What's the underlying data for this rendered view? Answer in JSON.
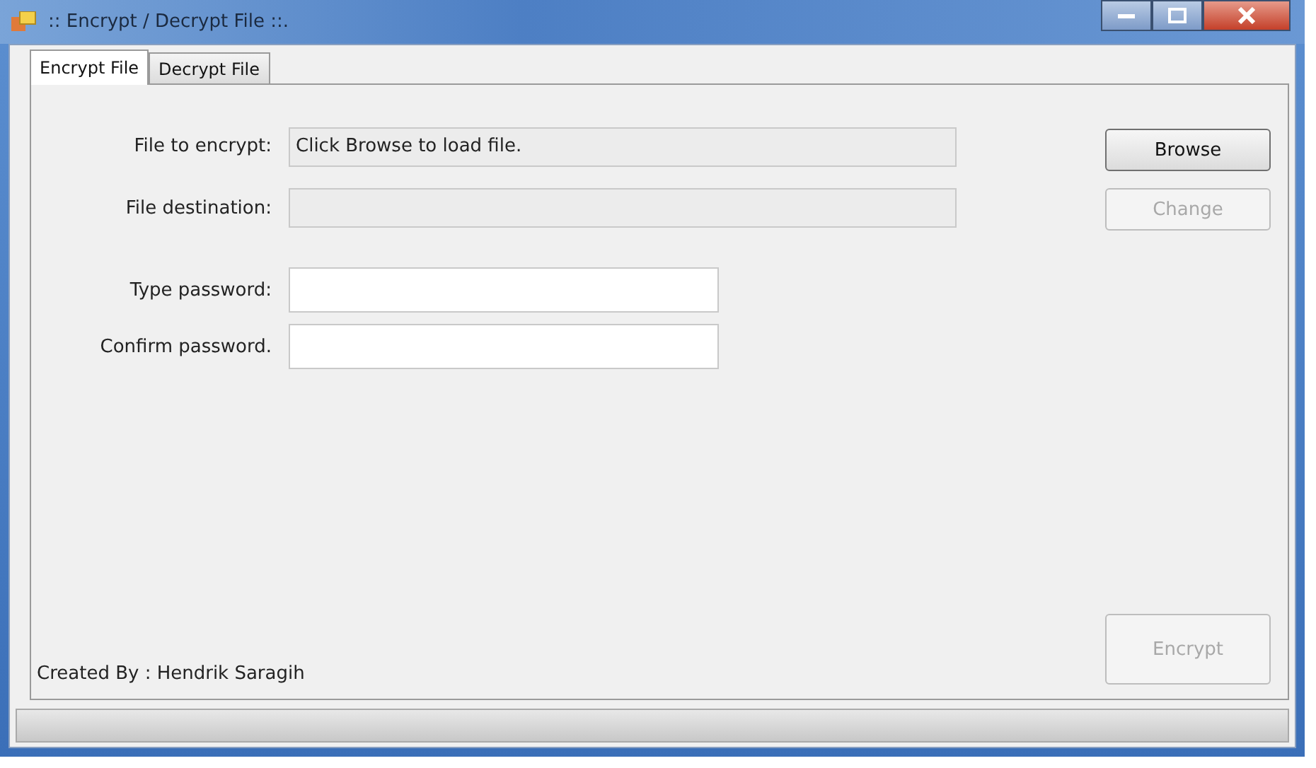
{
  "window": {
    "title": ":: Encrypt / Decrypt File ::."
  },
  "tabs": [
    {
      "label": "Encrypt File",
      "selected": true
    },
    {
      "label": "Decrypt File",
      "selected": false
    }
  ],
  "form": {
    "rows": [
      {
        "kind": "readonly",
        "label": "File to encrypt:",
        "value": "Click Browse to load file."
      },
      {
        "kind": "readonly",
        "label": "File destination:",
        "value": ""
      },
      {
        "kind": "password",
        "label": "Type password:",
        "value": ""
      },
      {
        "kind": "password",
        "label": "Confirm password.",
        "value": ""
      }
    ],
    "buttons": [
      {
        "label": "Browse",
        "disabled": false
      },
      {
        "label": "Change",
        "disabled": true
      }
    ],
    "action_button": {
      "label": "Encrypt",
      "disabled": true
    },
    "credit": "Created By : Hendrik Saragih"
  }
}
